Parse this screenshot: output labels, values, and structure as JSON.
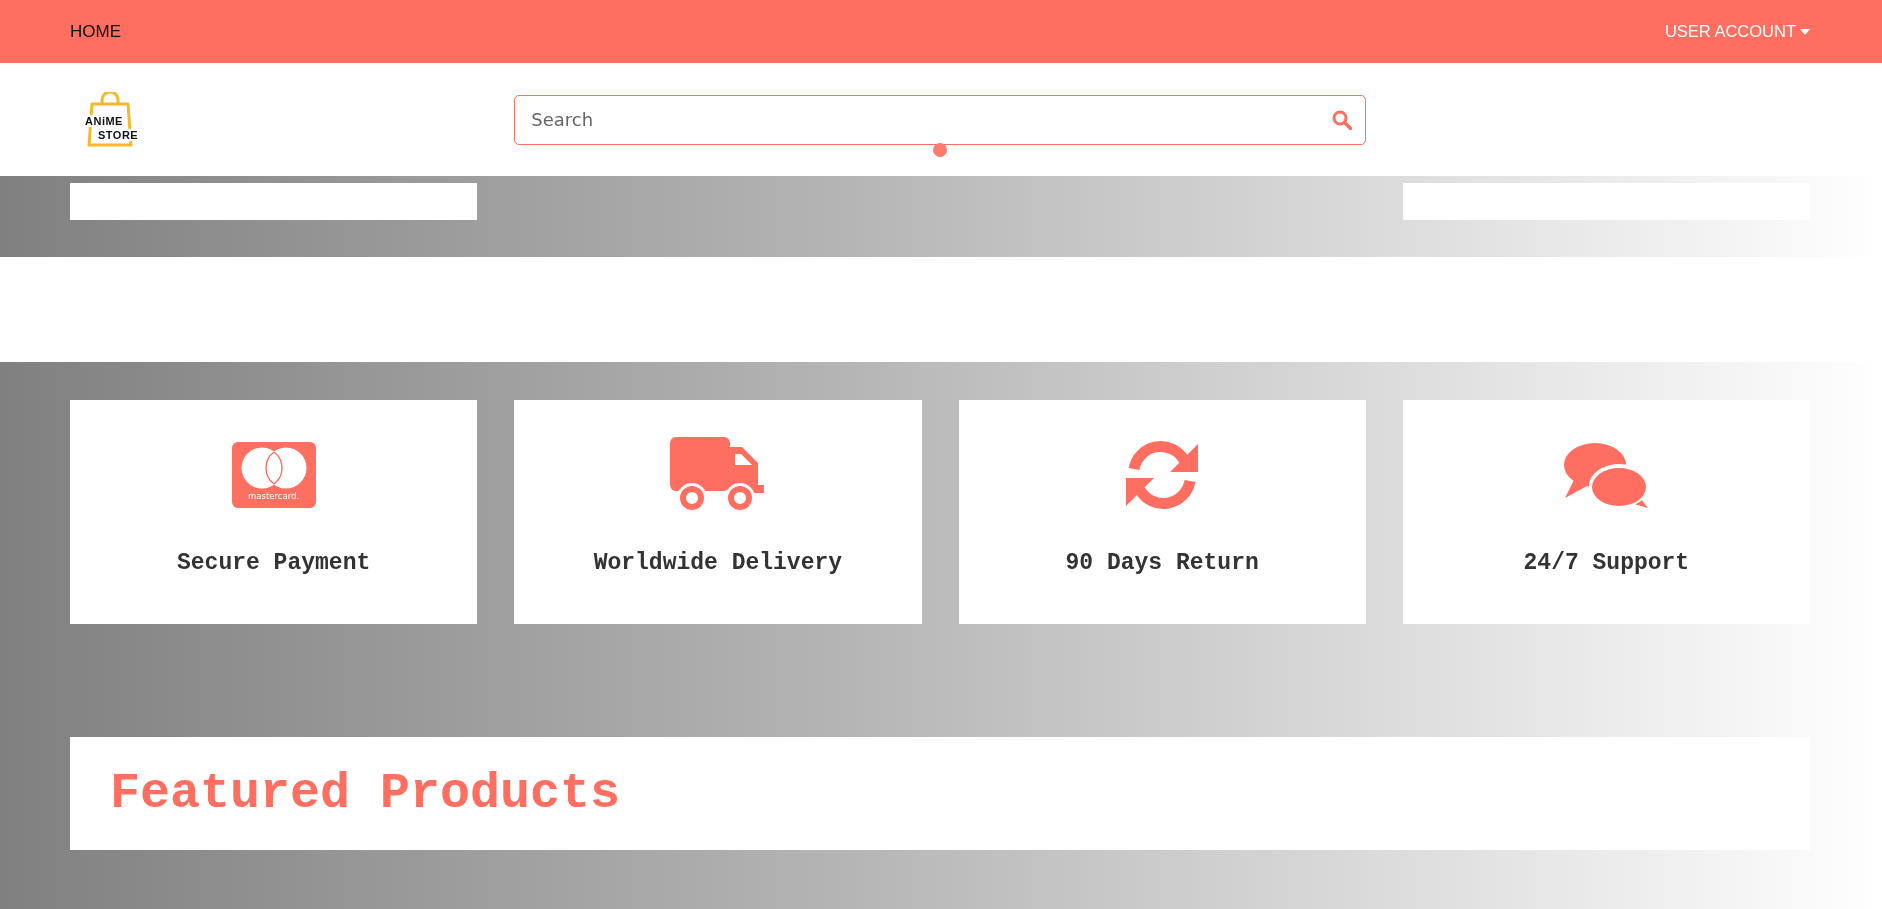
{
  "nav": {
    "home": "HOME",
    "account": "USER ACCOUNT"
  },
  "header": {
    "logo": {
      "line_1": "ANiME",
      "line_2": "STORE"
    },
    "search": {
      "placeholder": "Search"
    }
  },
  "features": [
    {
      "kind": "card",
      "label": "Secure Payment",
      "brand": "mastercard."
    },
    {
      "kind": "truck",
      "label": "Worldwide Delivery"
    },
    {
      "kind": "refresh",
      "label": "90 Days Return"
    },
    {
      "kind": "chat",
      "label": "24/7 Support"
    }
  ],
  "featured": {
    "title": "Featured Products"
  }
}
